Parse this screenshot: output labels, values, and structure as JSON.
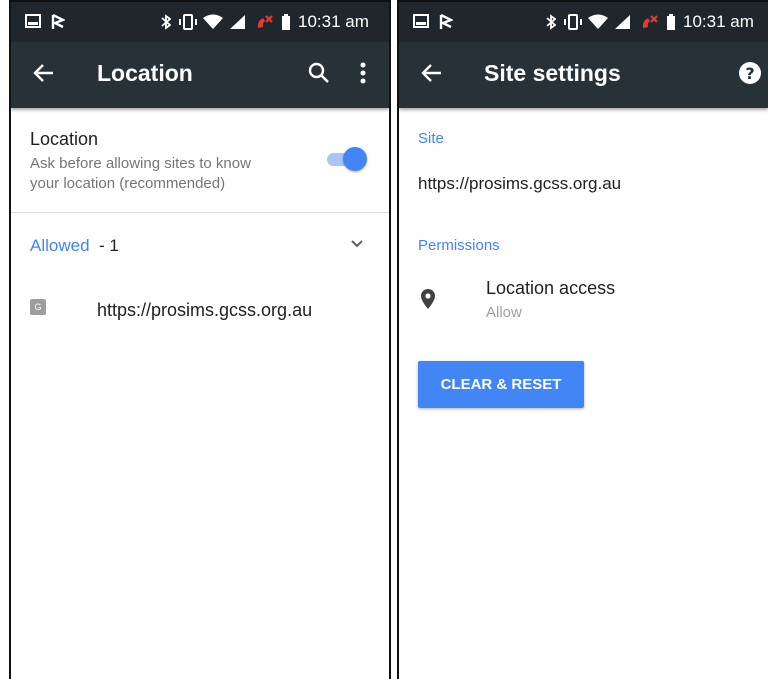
{
  "status_bar": {
    "time": "10:31 am"
  },
  "left": {
    "title": "Location",
    "location_row": {
      "title": "Location",
      "subtitle_line1": "Ask before allowing sites to know",
      "subtitle_line2": "your location (recommended)",
      "toggle_on": true
    },
    "allowed": {
      "label": "Allowed",
      "count": "- 1"
    },
    "site": {
      "favicon": "G",
      "url": "https://prosims.gcss.org.au"
    }
  },
  "right": {
    "title": "Site settings",
    "site_header": "Site",
    "site_url": "https://prosims.gcss.org.au",
    "permissions_header": "Permissions",
    "permission": {
      "title": "Location access",
      "value": "Allow"
    },
    "clear_button": "CLEAR & RESET"
  },
  "colors": {
    "accent": "#4285f4",
    "appbar": "#263238",
    "statusbar": "#1f272c"
  }
}
